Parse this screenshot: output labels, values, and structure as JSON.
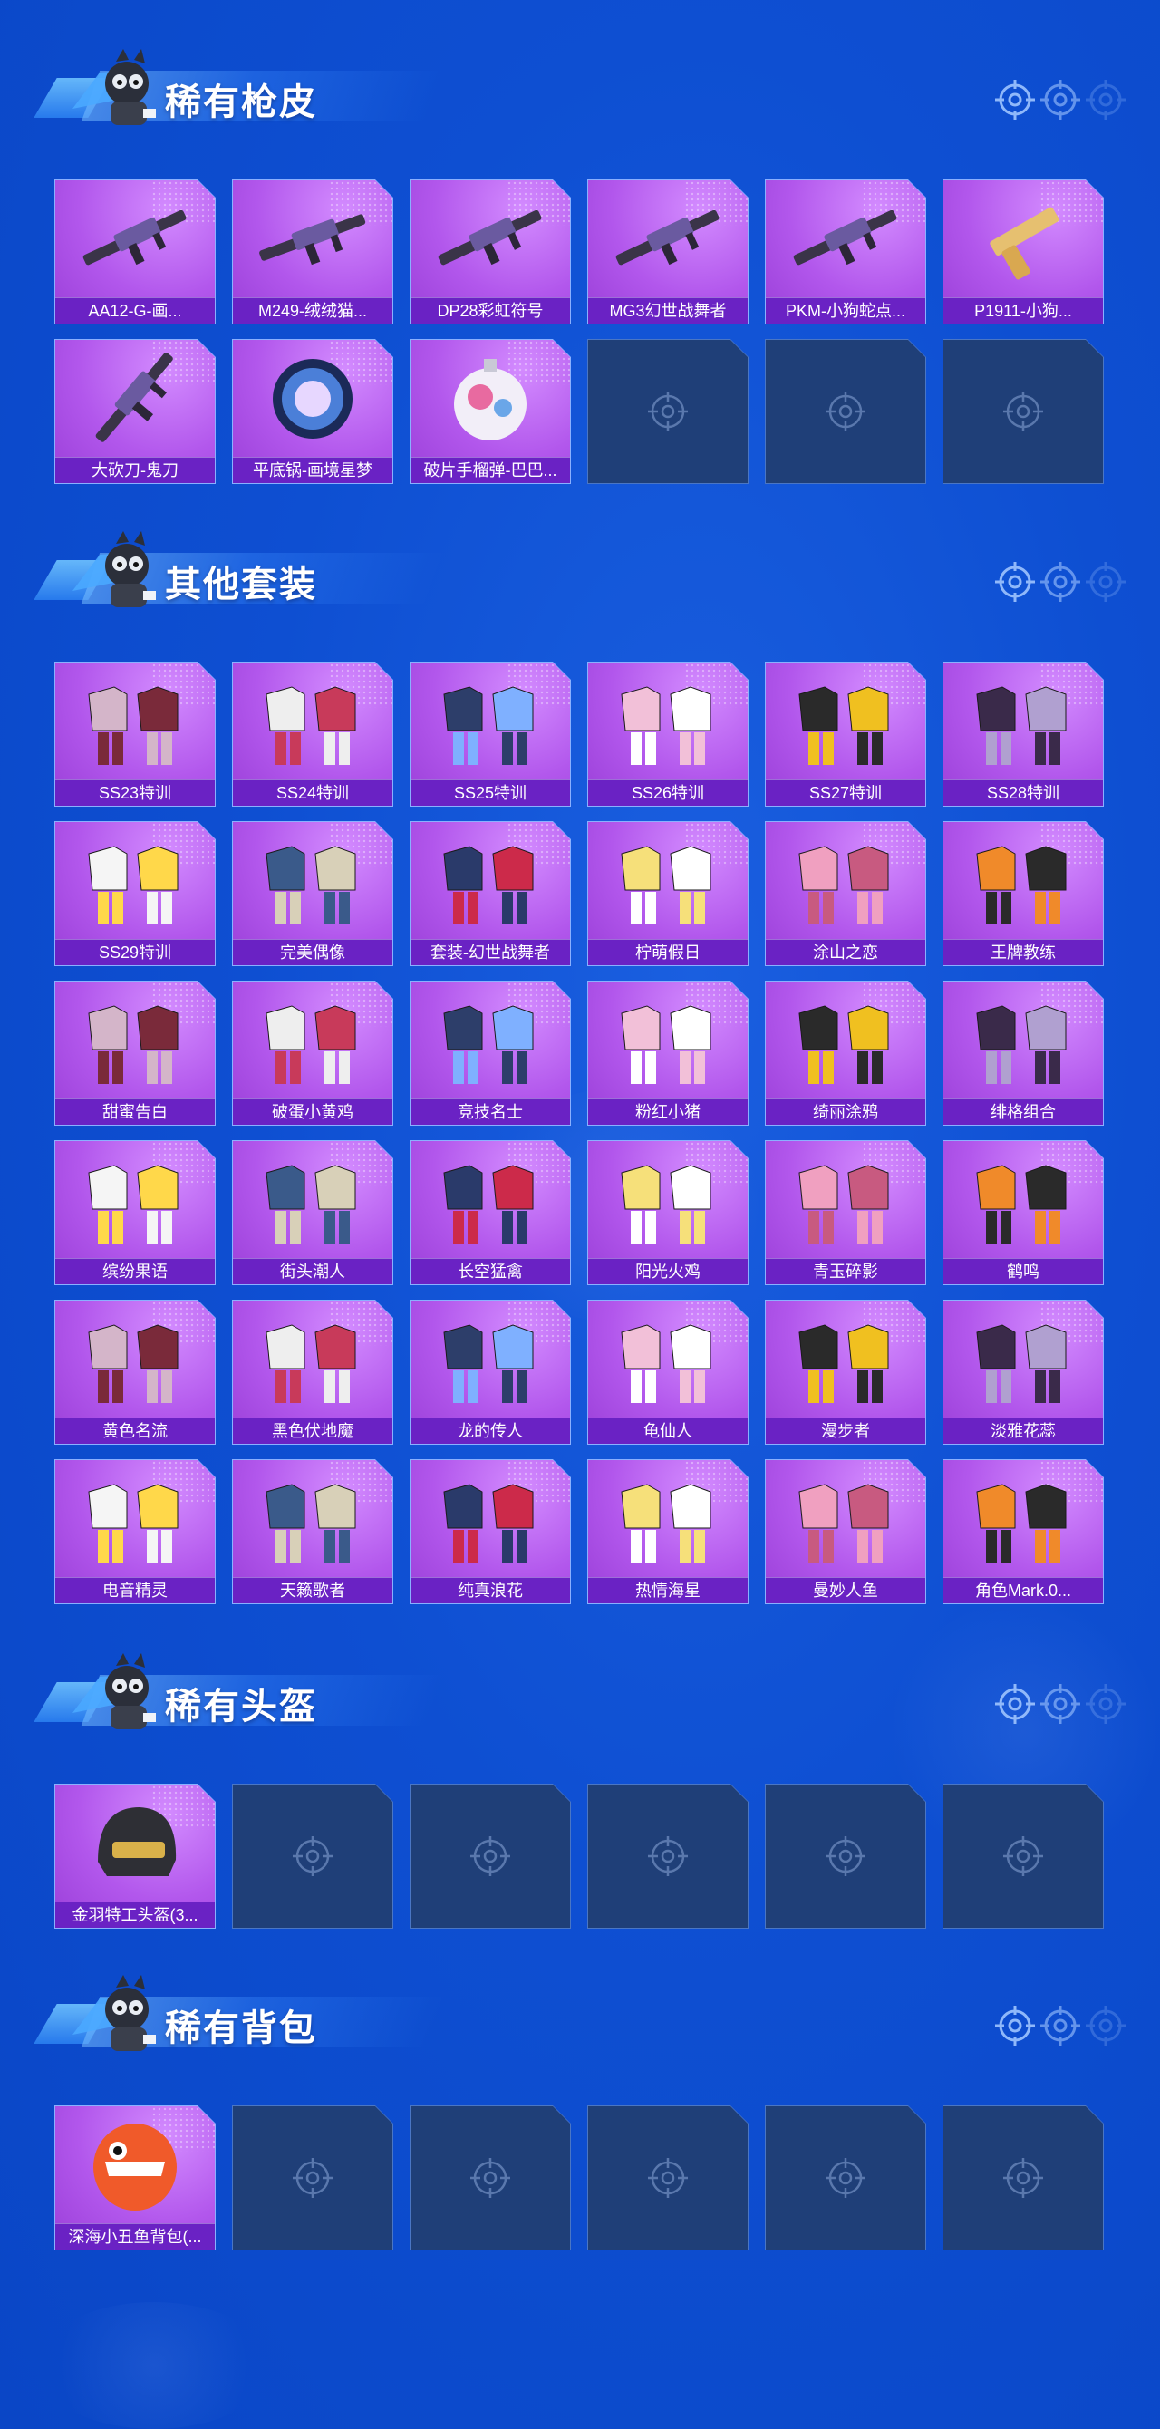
{
  "sections": {
    "rare_gun_skins": {
      "title": "稀有枪皮",
      "items": [
        "AA12-G-画...",
        "M249-绒绒猫...",
        "DP28彩虹符号",
        "MG3幻世战舞者",
        "PKM-小狗蛇点...",
        "P1911-小狗...",
        "大砍刀-鬼刀",
        "平底锅-画境星梦",
        "破片手榴弹-巴巴..."
      ],
      "empty_slots": 3
    },
    "other_outfits": {
      "title": "其他套装",
      "items": [
        "SS23特训",
        "SS24特训",
        "SS25特训",
        "SS26特训",
        "SS27特训",
        "SS28特训",
        "SS29特训",
        "完美偶像",
        "套装-幻世战舞者",
        "柠萌假日",
        "涂山之恋",
        "王牌教练",
        "甜蜜告白",
        "破蛋小黄鸡",
        "竞技名士",
        "粉红小猪",
        "绮丽涂鸦",
        "绯格组合",
        "缤纷果语",
        "街头潮人",
        "长空猛禽",
        "阳光火鸡",
        "青玉碎影",
        "鹤鸣",
        "黄色名流",
        "黑色伏地魔",
        "龙的传人",
        "龟仙人",
        "漫步者",
        "淡雅花蕊",
        "电音精灵",
        "天籁歌者",
        "纯真浪花",
        "热情海星",
        "曼妙人鱼",
        "角色Mark.0..."
      ],
      "empty_slots": 0
    },
    "rare_helmets": {
      "title": "稀有头盔",
      "items": [
        "金羽特工头盔(3..."
      ],
      "empty_slots": 5
    },
    "rare_backpacks": {
      "title": "稀有背包",
      "items": [
        "深海小丑鱼背包(..."
      ],
      "empty_slots": 5
    }
  },
  "colors": {
    "background": "#0e4fd2",
    "card_purple": "#b257ec",
    "label_purple": "#6a22c4",
    "empty_slot": "#1f3f78"
  }
}
